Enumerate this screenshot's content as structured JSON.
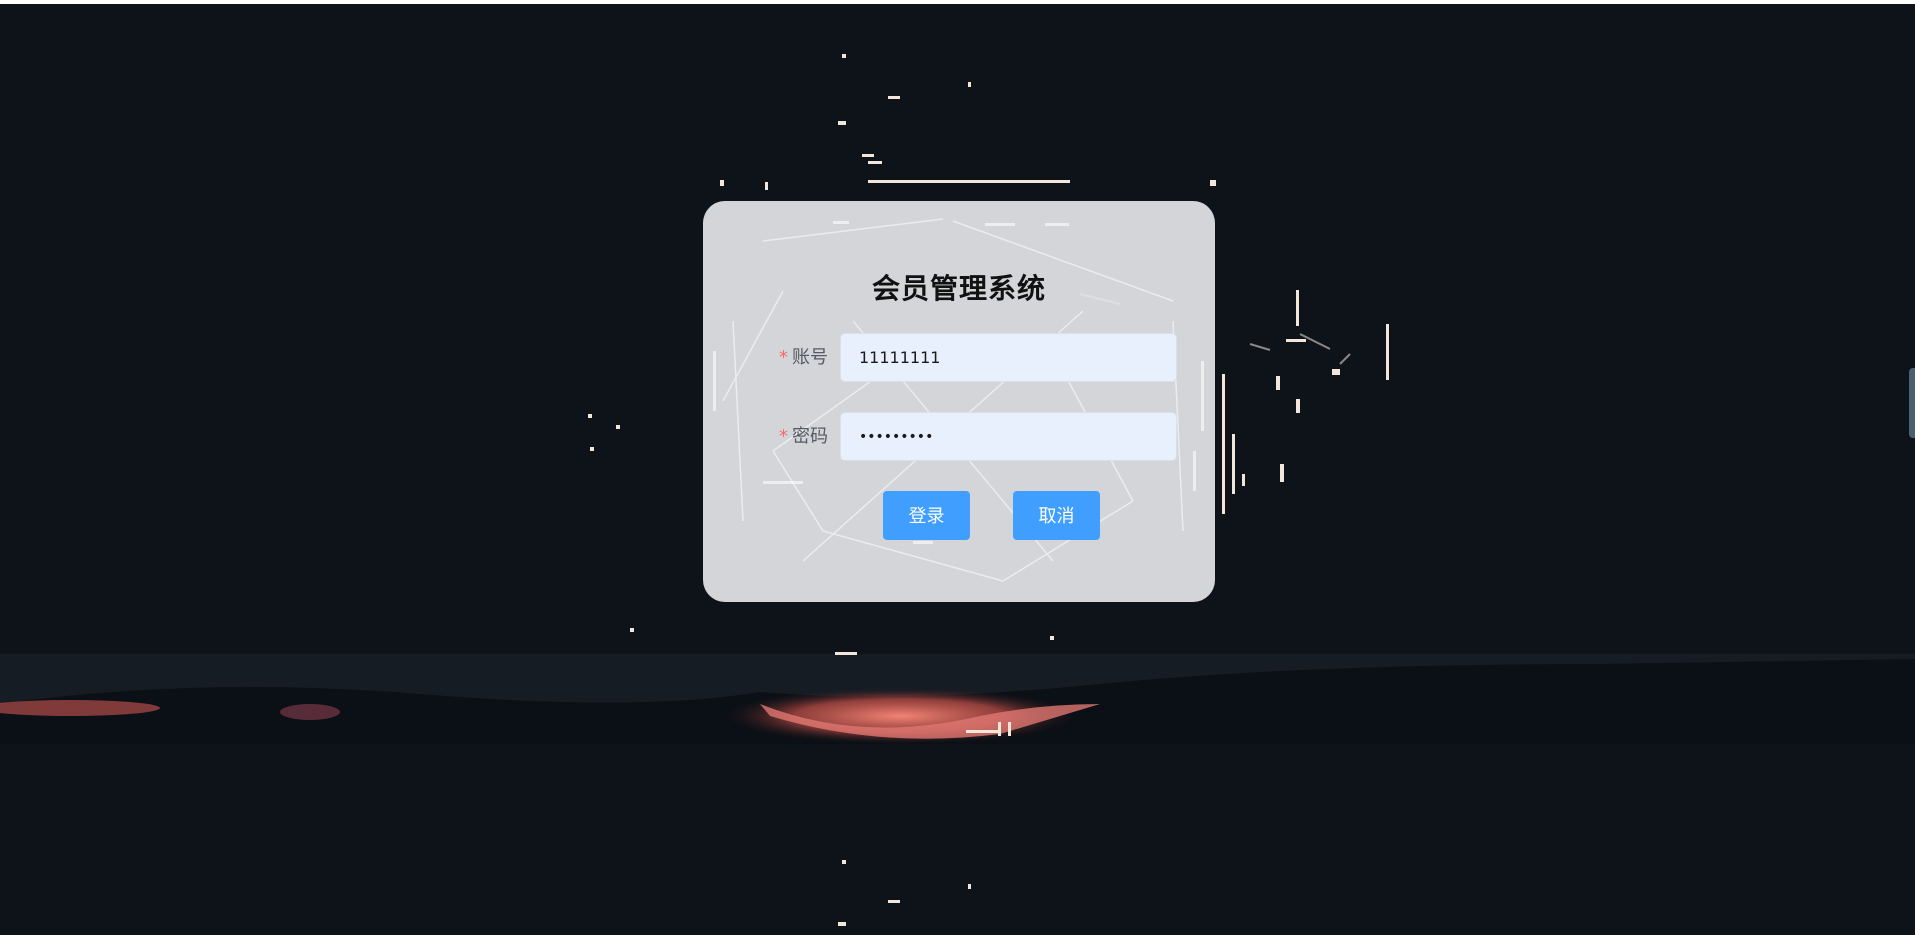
{
  "app": {
    "title": "会员管理系统"
  },
  "form": {
    "account": {
      "required_mark": "*",
      "label": "账号",
      "value": "11111111"
    },
    "password": {
      "required_mark": "*",
      "label": "密码",
      "value": "•••••••••"
    }
  },
  "actions": {
    "login_label": "登录",
    "cancel_label": "取消"
  },
  "colors": {
    "primary": "#409eff",
    "required": "#f56c6c",
    "background": "#0e131a",
    "input_autofill": "#e8f0fe"
  }
}
